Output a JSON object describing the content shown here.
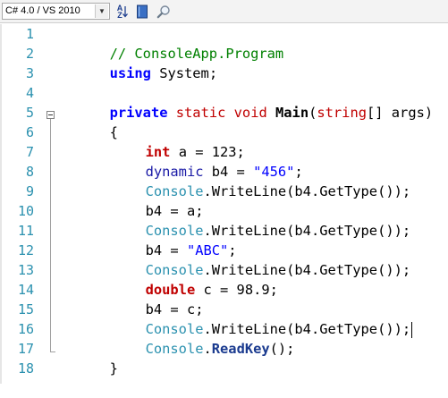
{
  "toolbar": {
    "version_select": "C# 4.0 / VS 2010",
    "sort_label_top": "A",
    "sort_label_bottom": "Z"
  },
  "editor": {
    "line_numbers": [
      "1",
      "2",
      "3",
      "4",
      "5",
      "6",
      "7",
      "8",
      "9",
      "10",
      "11",
      "12",
      "13",
      "14",
      "15",
      "16",
      "17",
      "18"
    ],
    "code": {
      "l1": "// ConsoleApp.Program",
      "l2_kw": "using",
      "l2_rest": " System;",
      "l4_private": "private",
      "l4_static": "static",
      "l4_void": "void",
      "l4_main": "Main",
      "l4_open": "(",
      "l4_string": "string",
      "l4_rest": "[] args)",
      "l5": "{",
      "l6_kw": "int",
      "l6_rest": " a = 123;",
      "l7_kw": "dynamic",
      "l7_mid": " b4 = ",
      "l7_str": "\"456\"",
      "l7_end": ";",
      "console": "Console",
      "writeline_call": ".WriteLine(b4.GetType());",
      "l9": "b4 = a;",
      "l11_mid": "b4 = ",
      "l11_str": "\"ABC\"",
      "l11_end": ";",
      "l13_kw": "double",
      "l13_rest": " c = 98.9;",
      "l14": "b4 = c;",
      "l16_dot": ".",
      "l16_method": "ReadKey",
      "l16_end": "();",
      "l17": "}"
    }
  }
}
